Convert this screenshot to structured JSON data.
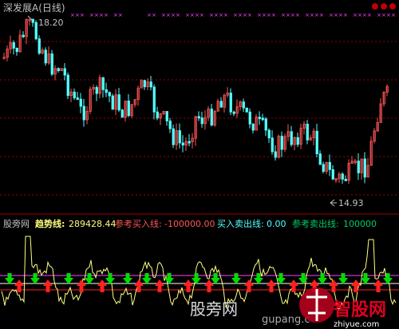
{
  "window": {
    "title": "深发展A(日线)"
  },
  "markers": {
    "high_label": "18.20",
    "low_label": "14.93"
  },
  "indicator": {
    "name": "股旁网",
    "trend_label": "趋势线:",
    "trend_value": "289428.44",
    "ref_buy_label": "参考买入线:",
    "ref_buy_value": "-100000.00",
    "buy_sell_label": "买入卖出线:",
    "buy_sell_value": "0.00",
    "ref_sell_label": "参考卖出线:",
    "ref_sell_value": "100000"
  },
  "watermark": {
    "text": "股旁网",
    "site_cn": "智股网",
    "site_url": "zhiyue.com"
  },
  "colors": {
    "up": "#ff5555",
    "down": "#54ffff",
    "grid": "#a00000",
    "trend": "#ffff80",
    "signal": "#ff40ff",
    "buy": "#00dd00",
    "sell": "#ff2020",
    "title": "#c0c0c0"
  },
  "icons": [
    "up-arrow-icon",
    "down-arrow-icon",
    "dropdown-indicator-icon"
  ]
}
